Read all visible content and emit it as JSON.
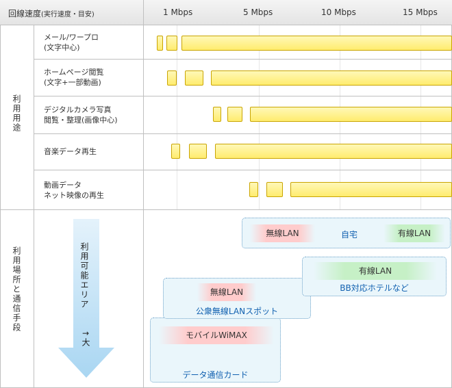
{
  "header": {
    "title_main": "回線速度",
    "title_sub": "(実行速度・目安)",
    "ticks": [
      "1 Mbps",
      "5 Mbps",
      "10 Mbps",
      "15 Mbps"
    ]
  },
  "section_usage": {
    "label": "利用用途",
    "rows": [
      {
        "label": "メール/ワープロ\n(文字中心)"
      },
      {
        "label": "ホームページ閲覧\n(文字+一部動画)"
      },
      {
        "label": "デジタルカメラ写真\n閲覧・整理(画像中心)"
      },
      {
        "label": "音楽データ再生"
      },
      {
        "label": "動画データ\nネット映像の再生"
      }
    ]
  },
  "section_location": {
    "label": "利用場所と通信手段",
    "arrow_label": "利用可能エリア",
    "arrow_suffix": "→大",
    "zones": {
      "home": {
        "wireless": "無線LAN",
        "place": "自宅",
        "wired": "有線LAN"
      },
      "hotel": {
        "wired": "有線LAN",
        "place": "BB対応ホテルなど"
      },
      "hotspot": {
        "wireless": "無線LAN",
        "place": "公衆無線LANスポット"
      },
      "mobile": {
        "name": "モバイルWiMAX",
        "place": "データ通信カード"
      }
    }
  },
  "colors": {
    "bar_fill": "#ffec6e",
    "bar_border": "#c9a400",
    "zone_fill": "#eaf6fb",
    "blue_text": "#1060b0"
  }
}
